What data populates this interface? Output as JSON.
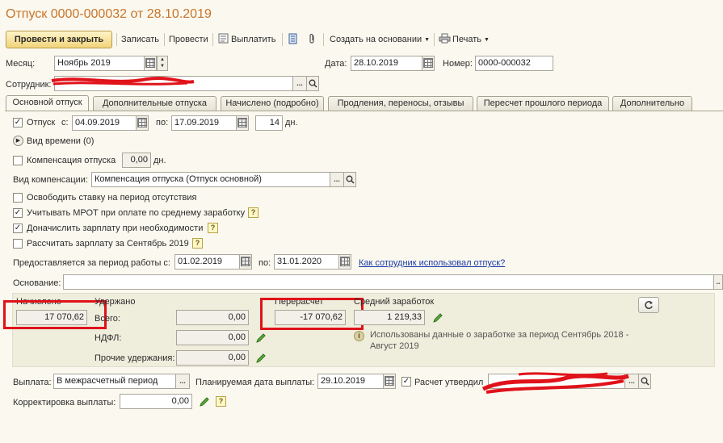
{
  "window": {
    "title": "Отпуск 0000-000032 от 28.10.2019"
  },
  "toolbar": {
    "post_close": "Провести и закрыть",
    "save": "Записать",
    "post": "Провести",
    "pay": "Выплатить",
    "create_based": "Создать на основании",
    "print": "Печать"
  },
  "header": {
    "month_label": "Месяц:",
    "month_value": "Ноябрь 2019",
    "date_label": "Дата:",
    "date_value": "28.10.2019",
    "number_label": "Номер:",
    "number_value": "0000-000032",
    "employee_label": "Сотрудник:"
  },
  "tabs": [
    {
      "label": "Основной отпуск",
      "active": true
    },
    {
      "label": "Дополнительные отпуска"
    },
    {
      "label": "Начислено (подробно)"
    },
    {
      "label": "Продления, переносы, отзывы"
    },
    {
      "label": "Пересчет прошлого периода"
    },
    {
      "label": "Дополнительно"
    }
  ],
  "main": {
    "vacation_label": "Отпуск",
    "vacation_checked": true,
    "from_label": "с:",
    "from_value": "04.09.2019",
    "to_label": "по:",
    "to_value": "17.09.2019",
    "days_value": "14",
    "days_unit": "дн.",
    "time_type_label": "Вид времени (0)",
    "compensation_label": "Компенсация отпуска",
    "compensation_value": "0,00",
    "compensation_unit": "дн.",
    "compensation_type_label": "Вид компенсации:",
    "compensation_type_value": "Компенсация отпуска (Отпуск основной)",
    "options": [
      {
        "label": "Освободить ставку на период отсутствия",
        "checked": false,
        "help": false
      },
      {
        "label": "Учитывать МРОТ при оплате по среднему заработку",
        "checked": true,
        "help": true
      },
      {
        "label": "Доначислить зарплату при необходимости",
        "checked": true,
        "help": true
      },
      {
        "label": "Рассчитать зарплату за Сентябрь 2019",
        "checked": false,
        "help": true
      }
    ],
    "work_period_label": "Предоставляется за период работы с:",
    "work_period_from": "01.02.2019",
    "work_period_to_label": "по:",
    "work_period_to": "31.01.2020",
    "usage_link": "Как сотрудник использовал отпуск?",
    "basis_label": "Основание:",
    "help_mark": "?"
  },
  "summary": {
    "accrued_label": "Начислено",
    "accrued_value": "17 070,62",
    "withheld_label": "Удержано",
    "total_label": "Всего:",
    "total_value": "0,00",
    "ndfl_label": "НДФЛ:",
    "ndfl_value": "0,00",
    "other_label": "Прочие удержания:",
    "other_value": "0,00",
    "recalc_label": "Перерасчет",
    "recalc_value": "-17 070,62",
    "avg_label": "Средний заработок",
    "avg_value": "1 219,33",
    "info_text": "Использованы данные о заработке за период Сентябрь 2018 - Август 2019"
  },
  "payment": {
    "payout_label": "Выплата:",
    "payout_value": "В межрасчетный период",
    "planned_date_label": "Планируемая дата выплаты:",
    "planned_date_value": "29.10.2019",
    "approved_label": "Расчет утвердил",
    "approved_checked": true,
    "adjust_label": "Корректировка выплаты:",
    "adjust_value": "0,00"
  },
  "colors": {
    "title": "#c8742a",
    "redact": "#e0121a",
    "link": "#1b3aa8"
  }
}
